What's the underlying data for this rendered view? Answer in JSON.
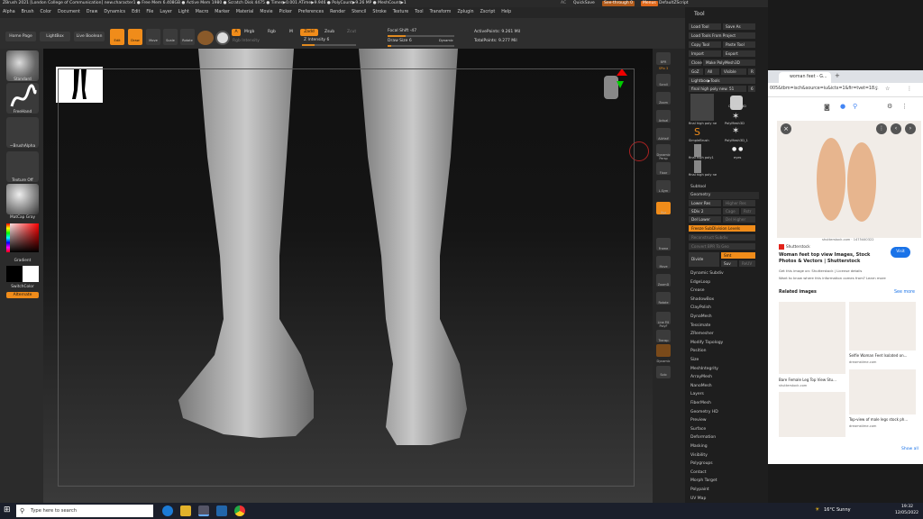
{
  "titlebar": {
    "text": "ZBrush 2021 [London College of Communication]   new.character1   ● Free Mem 6.408GB ● Active Mem 1980 ● Scratch Disk 4475 ● Timer▶0.001 ATime▶9.946 ● PolyCount▶9.26 MP ● MeshCount▶1",
    "ac": "AC",
    "quicksave": "QuickSave",
    "seethrough": "See-through   0",
    "menus": "Menus",
    "script": "DefaultZScript"
  },
  "menubar": [
    "Alpha",
    "Brush",
    "Color",
    "Document",
    "Draw",
    "Dynamics",
    "Edit",
    "File",
    "Layer",
    "Light",
    "Macro",
    "Marker",
    "Material",
    "Movie",
    "Picker",
    "Preferences",
    "Render",
    "Stencil",
    "Stroke",
    "Texture",
    "Tool",
    "Transform",
    "Zplugin",
    "Zscript",
    "Help"
  ],
  "shelf": {
    "home_page": "Home Page",
    "lightbox": "LightBox",
    "live_boolean": "Live Boolean",
    "edit": "Edit",
    "draw": "Draw",
    "move": "Move",
    "scale": "Scale",
    "rotate": "Rotate",
    "a": "A",
    "mrgb": "Mrgb",
    "rgb": "Rgb",
    "m": "M",
    "zadd": "Zadd",
    "zsub": "Zsub",
    "zcut": "Zcut",
    "rgb_intensity": "Rgb Intensity",
    "z_intensity": "Z Intensity 6",
    "focal_shift": "Focal Shift -47",
    "draw_size": "Draw Size 6",
    "dynamic": "Dynamic",
    "active_points": "ActivePoints: 9.261 Mil",
    "total_points": "TotalPoints: 9.277 Mil"
  },
  "left_tray": {
    "standard": "Standard",
    "freehand": "FreeHand",
    "brushalpha": "~BrushAlpha",
    "texture_off": "Texture Off",
    "matcap": "MatCap Gray",
    "gradient": "Gradient",
    "switchcolor": "SwitchColor",
    "alternate": "Alternate"
  },
  "right_dock": [
    "BPR",
    "SPix 3",
    "Scroll",
    "Zoom",
    "Actual",
    "AAHalf",
    "Dynamic Persp",
    "Floor",
    "L.Sym",
    "Xyz",
    "Frame",
    "Move",
    "ZoomD",
    "Rotate",
    "Line Fill PolyF",
    "Transp",
    "Dynamic",
    "Solo"
  ],
  "tool_palette": {
    "title": "Tool",
    "load_tool": "Load Tool",
    "save_as": "Save As",
    "load_from_project": "Load Tools From Project",
    "copy_tool": "Copy Tool",
    "paste_tool": "Paste Tool",
    "import": "Import",
    "export": "Export",
    "clone": "Clone",
    "make_polymesh": "Make PolyMesh3D",
    "goz": "GoZ",
    "all": "All",
    "visible": "Visible",
    "r": "R",
    "lightbox_tools": "Lightbox▶Tools",
    "current_tool": "final high poly new. 51",
    "current_count": "6",
    "thumbs": [
      "final high poly ne",
      "Cylinder3D",
      "PolyMesh3D",
      "SimpleBrush",
      "PolyMesh3D_1",
      "final high poly1",
      "eyes",
      "final high poly ne"
    ],
    "subtool": "Subtool",
    "geometry": "Geometry",
    "lower_res": "Lower Res",
    "higher_res": "Higher Res",
    "sdiv": "SDiv 2",
    "cage": "Cage",
    "rstr": "Rstr",
    "del_lower": "Del Lower",
    "del_higher": "Del Higher",
    "freeze": "Freeze SubDivision Levels",
    "reconstruct": "Reconstruct Subdiv",
    "convert_bpr": "Convert BPR To Geo",
    "divide": "Divide",
    "smt": "Smt",
    "suv": "Suv",
    "reuv": "ReUV",
    "sections": [
      "Dynamic Subdiv",
      "EdgeLoop",
      "Crease",
      "ShadowBox",
      "ClayPolish",
      "DynaMesh",
      "Tessimate",
      "ZRemesher",
      "Modify Topology",
      "Position",
      "Size",
      "MeshIntegrity",
      "ArrayMesh",
      "NanoMesh",
      "Layers",
      "FiberMesh",
      "Geometry HD",
      "Preview",
      "Surface",
      "Deformation",
      "Masking",
      "Visibility",
      "Polygroups",
      "Contact",
      "Morph Target",
      "Polypaint",
      "UV Map"
    ]
  },
  "chrome": {
    "tab_title": "woman feet - G...",
    "address": "005&tbm=isch&source=iu&ictx=1&fir=tvet=18...",
    "image_caption": "shutterstock.com · 1475440322",
    "source": "Shutterstock",
    "result_title": "Woman feet top view Images, Stock Photos & Vectors | Shutterstock",
    "visit": "Visit",
    "get_image": "Get this image on: Shutterstock | License details",
    "want_know": "Want to know where this information comes from? Learn more",
    "related": "Related images",
    "see_more": "See more",
    "related_items": [
      {
        "title": "Bare Female Leg Top View Stu...",
        "site": "shutterstock.com"
      },
      {
        "title": "Selfie Woman Feet Isolated on...",
        "site": "dreamstime.com"
      },
      {
        "title": "Top-view of male legs stock ph...",
        "site": "dreamstime.com"
      }
    ],
    "show_all": "Show all"
  },
  "taskbar": {
    "search_placeholder": "Type here to search",
    "weather": "16°C  Sunny",
    "time": "19:32",
    "date": "12/05/2022"
  }
}
